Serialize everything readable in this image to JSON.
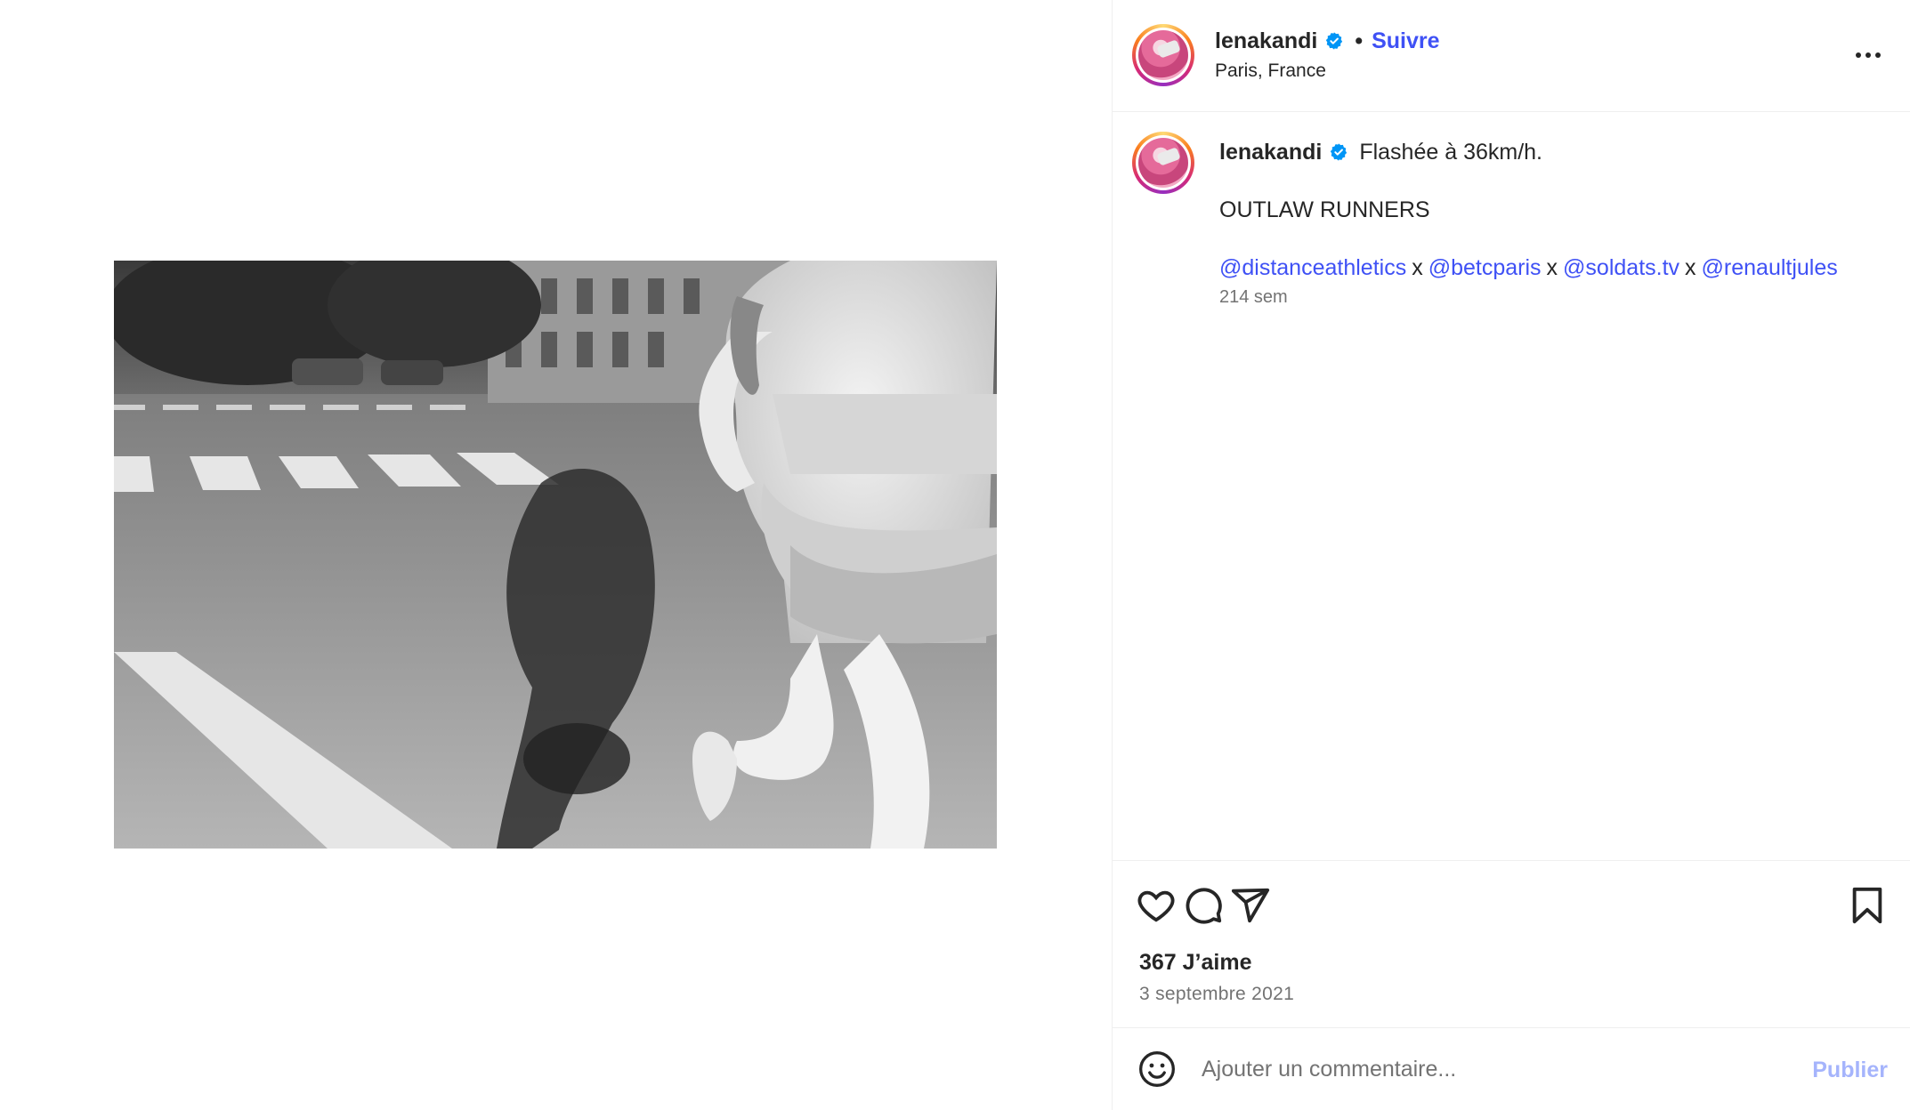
{
  "post": {
    "username": "lenakandi",
    "follow_label": "Suivre",
    "separator": "•",
    "location": "Paris, France",
    "more_icon": "more-horizontal-icon",
    "verified_icon": "verified-badge-icon",
    "caption": {
      "text": "Flashée à 36km/h.",
      "title": "OUTLAW RUNNERS",
      "tags": [
        "@distanceathletics",
        "@betcparis",
        "@soldats.tv",
        "@renaultjules"
      ],
      "tag_separator": "x",
      "time": "214 sem"
    },
    "likes": "367 J’aime",
    "date": "3 septembre 2021"
  },
  "actions": {
    "like_icon": "heart-icon",
    "comment_icon": "comment-icon",
    "share_icon": "send-icon",
    "save_icon": "bookmark-icon"
  },
  "comment": {
    "placeholder": "Ajouter un commentaire...",
    "publish_label": "Publier",
    "emoji_icon": "emoji-icon"
  },
  "colors": {
    "link": "#3f51f5",
    "verified": "#0095f6",
    "publish_disabled": "#a5b4fc"
  }
}
